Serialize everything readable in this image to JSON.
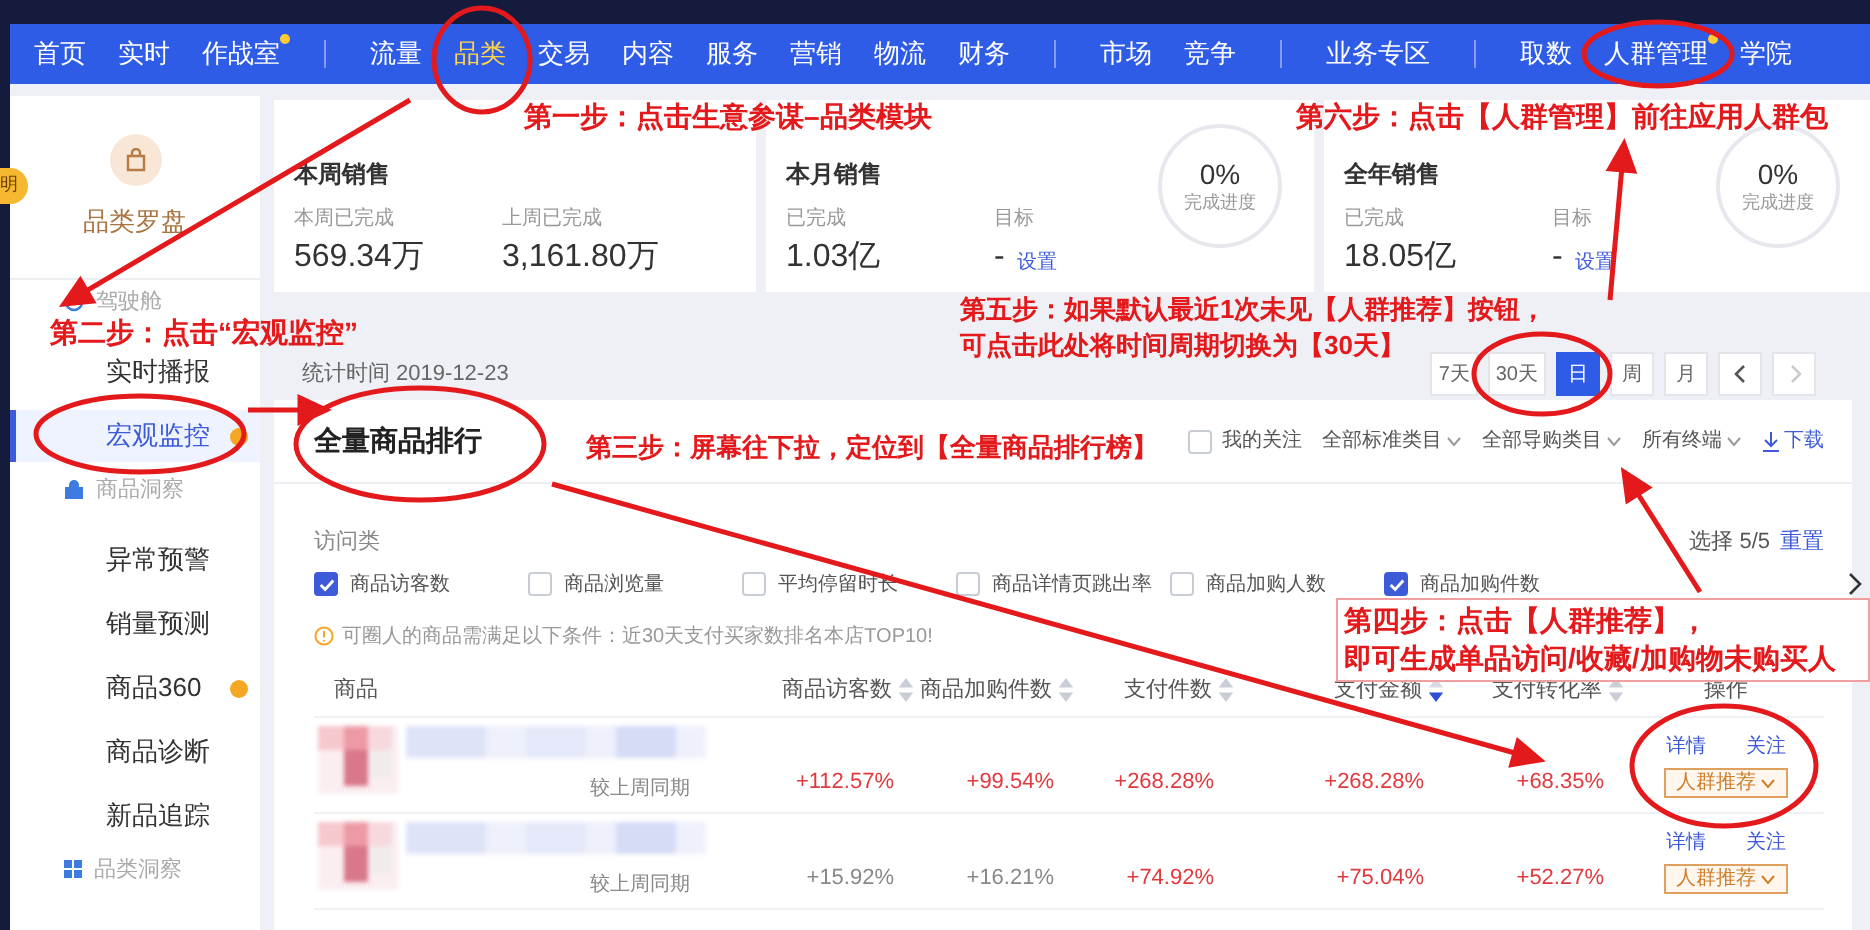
{
  "nav": {
    "groups": [
      [
        {
          "label": "首页",
          "selected": false,
          "dot": false
        },
        {
          "label": "实时",
          "selected": false,
          "dot": false
        },
        {
          "label": "作战室",
          "selected": false,
          "dot": true
        }
      ],
      [
        {
          "label": "流量",
          "selected": false,
          "dot": false
        },
        {
          "label": "品类",
          "selected": true,
          "dot": false
        },
        {
          "label": "交易",
          "selected": false,
          "dot": false
        },
        {
          "label": "内容",
          "selected": false,
          "dot": false
        },
        {
          "label": "服务",
          "selected": false,
          "dot": false
        },
        {
          "label": "营销",
          "selected": false,
          "dot": false
        },
        {
          "label": "物流",
          "selected": false,
          "dot": false
        },
        {
          "label": "财务",
          "selected": false,
          "dot": false
        }
      ],
      [
        {
          "label": "市场",
          "selected": false,
          "dot": false
        },
        {
          "label": "竞争",
          "selected": false,
          "dot": false
        }
      ],
      [
        {
          "label": "业务专区",
          "selected": false,
          "dot": false
        }
      ],
      [
        {
          "label": "取数",
          "selected": false,
          "dot": false
        },
        {
          "label": "人群管理",
          "selected": false,
          "dot": true
        },
        {
          "label": "学院",
          "selected": false,
          "dot": false
        }
      ]
    ]
  },
  "sidebar": {
    "badge": "明",
    "title": "品类罗盘",
    "sections": [
      {
        "label": "驾驶舱",
        "kind": "cockpit",
        "items": [
          {
            "label": "实时播报",
            "selected": false,
            "dot": false
          },
          {
            "label": "宏观监控",
            "selected": true,
            "dot": true
          }
        ]
      },
      {
        "label": "商品洞察",
        "kind": "bag",
        "items": [
          {
            "label": "异常预警",
            "selected": false,
            "dot": false
          },
          {
            "label": "销量预测",
            "selected": false,
            "dot": false
          },
          {
            "label": "商品360",
            "selected": false,
            "dot": true
          },
          {
            "label": "商品诊断",
            "selected": false,
            "dot": false
          },
          {
            "label": "新品追踪",
            "selected": false,
            "dot": false
          }
        ]
      },
      {
        "label": "品类洞察",
        "kind": "grid"
      }
    ]
  },
  "summary_cards": [
    {
      "title": "本周销售",
      "metrics": [
        {
          "label": "本周已完成",
          "value": "569.34万"
        },
        {
          "label": "上周已完成",
          "value": "3,161.80万"
        }
      ]
    },
    {
      "title": "本月销售",
      "metrics": [
        {
          "label": "已完成",
          "value": "1.03亿"
        },
        {
          "label": "目标",
          "value": "-",
          "link": "设置"
        }
      ],
      "progress": {
        "value": "0%",
        "label": "完成进度"
      }
    },
    {
      "title": "全年销售",
      "metrics": [
        {
          "label": "已完成",
          "value": "18.05亿"
        },
        {
          "label": "目标",
          "value": "-",
          "link": "设置"
        }
      ],
      "progress": {
        "value": "0%",
        "label": "完成进度"
      }
    }
  ],
  "stat_time": "统计时间 2019-12-23",
  "period_buttons": [
    {
      "kind": "text",
      "label": "7天",
      "selected": false
    },
    {
      "kind": "text",
      "label": "30天",
      "selected": false
    },
    {
      "kind": "text",
      "label": "日",
      "selected": true
    },
    {
      "kind": "text",
      "label": "周",
      "selected": false
    },
    {
      "kind": "text",
      "label": "月",
      "selected": false
    },
    {
      "kind": "prev",
      "disabled": false
    },
    {
      "kind": "next",
      "disabled": true
    }
  ],
  "ranking": {
    "title": "全量商品排行",
    "filters": [
      {
        "kind": "checkbox",
        "label": "我的关注",
        "checked": false
      },
      {
        "kind": "dropdown",
        "label": "全部标准类目"
      },
      {
        "kind": "dropdown",
        "label": "全部导购类目"
      },
      {
        "kind": "dropdown",
        "label": "所有终端"
      }
    ],
    "download": "下载",
    "metric_group": {
      "label": "访问类",
      "selection": "选择 5/5",
      "reset": "重置",
      "options": [
        {
          "label": "商品访客数",
          "checked": true
        },
        {
          "label": "商品浏览量",
          "checked": false
        },
        {
          "label": "平均停留时长",
          "checked": false
        },
        {
          "label": "商品详情页跳出率",
          "checked": false
        },
        {
          "label": "商品加购人数",
          "checked": false
        },
        {
          "label": "商品加购件数",
          "checked": true
        }
      ]
    },
    "notice": "可圈人的商品需满足以下条件：近30天支付买家数排名本店TOP10!",
    "table": {
      "columns": [
        {
          "label": "商品"
        },
        {
          "label": "商品访客数",
          "sortable": true,
          "sorted": false
        },
        {
          "label": "商品加购件数",
          "sortable": true,
          "sorted": false
        },
        {
          "label": "支付件数",
          "sortable": true,
          "sorted": false
        },
        {
          "label": "支付金额",
          "sortable": true,
          "sorted": true
        },
        {
          "label": "支付转化率",
          "sortable": true,
          "sorted": false
        },
        {
          "label": "操作"
        }
      ],
      "rows": [
        {
          "compare_label": "较上周同期",
          "changes": [
            {
              "value": "+112.57%",
              "highlight": true
            },
            {
              "value": "+99.54%",
              "highlight": true
            },
            {
              "value": "+268.28%",
              "highlight": true
            },
            {
              "value": "+268.28%",
              "highlight": true
            },
            {
              "value": "+68.35%",
              "highlight": true
            }
          ],
          "actions": {
            "details": "详情",
            "follow": "关注",
            "recommend": "人群推荐"
          }
        },
        {
          "compare_label": "较上周同期",
          "changes": [
            {
              "value": "+15.92%",
              "highlight": false
            },
            {
              "value": "+16.21%",
              "highlight": false
            },
            {
              "value": "+74.92%",
              "highlight": true
            },
            {
              "value": "+75.04%",
              "highlight": true
            },
            {
              "value": "+52.27%",
              "highlight": true
            }
          ],
          "actions": {
            "details": "详情",
            "follow": "关注",
            "recommend": "人群推荐"
          }
        }
      ]
    }
  },
  "annotations": [
    {
      "kind": "note",
      "text": "第一步：点击生意参谋–品类模块"
    },
    {
      "kind": "note",
      "text": "第六步：点击【人群管理】前往应用人群包"
    },
    {
      "kind": "note",
      "text": "第二步：点击“宏观监控”"
    },
    {
      "kind": "note_lines",
      "lines": [
        "第五步：如果默认最近1次未见【人群推荐】按钮，",
        "可点击此处将时间周期切换为【30天】"
      ]
    },
    {
      "kind": "note",
      "text": "第三步：屏幕往下拉，定位到【全量商品排行榜】"
    },
    {
      "kind": "boxed",
      "lines": [
        "第四步：点击【人群推荐】，",
        "即可生成单品访问/收藏/加购物未购买人"
      ]
    }
  ]
}
